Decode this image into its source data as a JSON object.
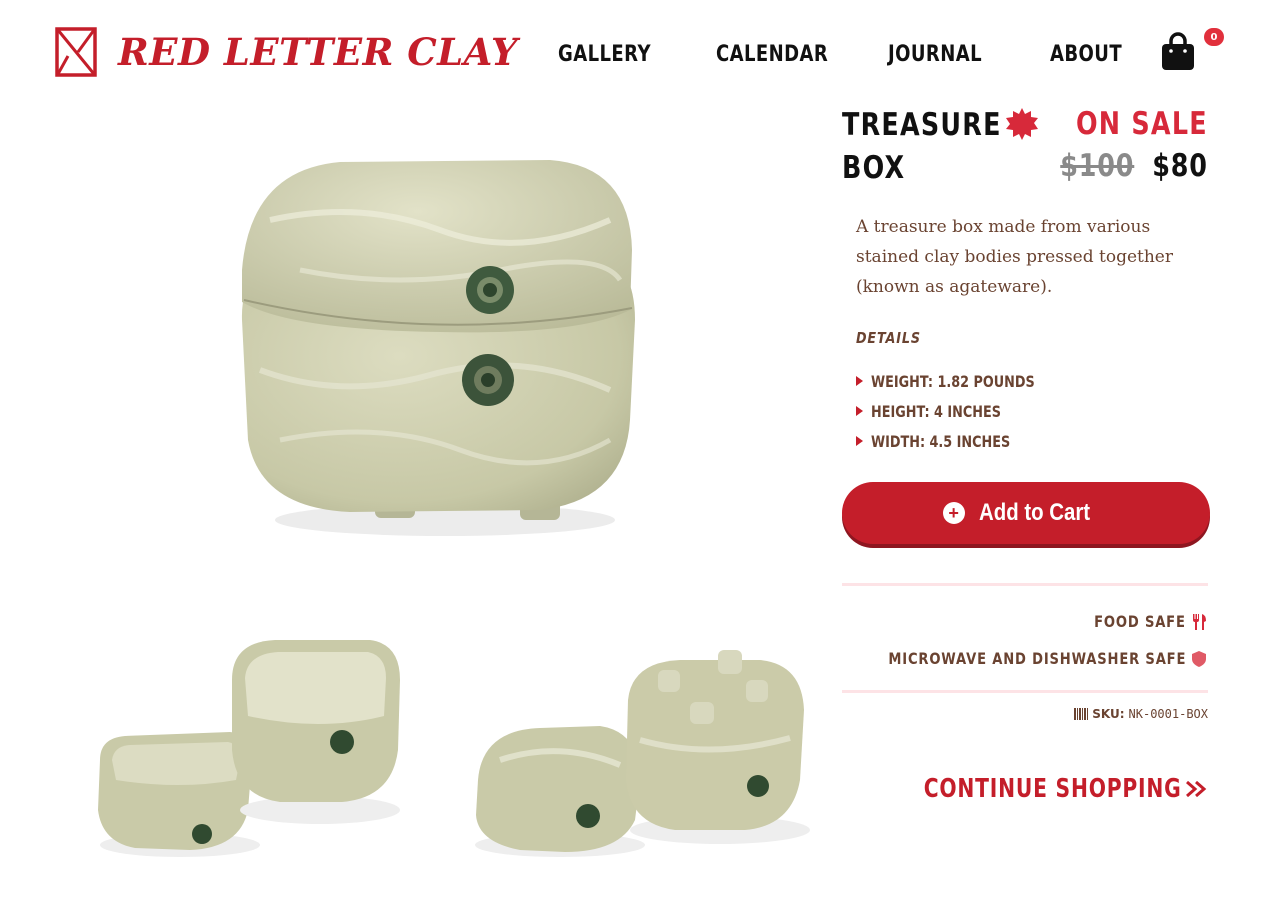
{
  "brand": {
    "name": "RED LETTER CLAY"
  },
  "nav": [
    {
      "label": "GALLERY"
    },
    {
      "label": "CALENDAR"
    },
    {
      "label": "JOURNAL"
    },
    {
      "label": "ABOUT"
    }
  ],
  "cart": {
    "count": "0",
    "icon": "shopping-bag-icon"
  },
  "product": {
    "title": "TREASURE BOX",
    "sale_label": "ON SALE",
    "original_price": "$100",
    "sale_price": "$80",
    "description": "A treasure box made from various stained clay bodies pressed together (known as agateware).",
    "details_label": "DETAILS",
    "details": [
      "WEIGHT: 1.82 POUNDS",
      "HEIGHT: 4 INCHES",
      "WIDTH: 4.5 INCHES"
    ],
    "add_to_cart": "Add to Cart",
    "features": [
      {
        "label": "FOOD SAFE",
        "icon": "utensils-icon"
      },
      {
        "label": "MICROWAVE AND DISHWASHER SAFE",
        "icon": "shield-icon"
      }
    ],
    "sku_label": "SKU:",
    "sku": "NK-0001-BOX",
    "continue": "CONTINUE SHOPPING"
  },
  "colors": {
    "brand_red": "#c41e2a",
    "sale_red": "#d7293a",
    "text_brown": "#6a4331",
    "divider_pink": "#fde3e6",
    "pottery_green": "#c7c8a6"
  }
}
